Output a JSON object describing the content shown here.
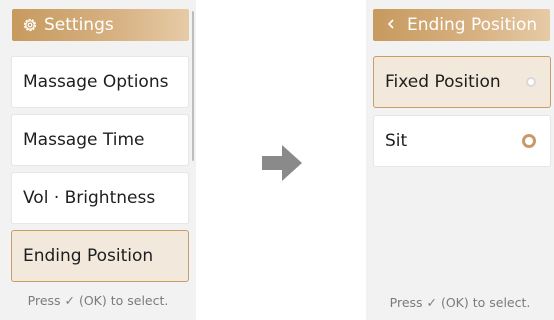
{
  "left_screen": {
    "header": {
      "title": "Settings",
      "icon": "gear-icon"
    },
    "items": [
      {
        "label": "Massage Options",
        "selected": false
      },
      {
        "label": "Massage Time",
        "selected": false
      },
      {
        "label": "Vol · Brightness",
        "selected": false
      },
      {
        "label": "Ending Position",
        "selected": true
      }
    ],
    "hint": "Press ✓ (OK) to select."
  },
  "right_screen": {
    "header": {
      "title": "Ending Position",
      "icon": "chevron-left-icon"
    },
    "options": [
      {
        "label": "Fixed Position",
        "selected": false,
        "highlighted": true
      },
      {
        "label": "Sit",
        "selected": true,
        "highlighted": false
      }
    ],
    "hint": "Press ✓ (OK) to select."
  },
  "colors": {
    "accent": "#c89d66",
    "header_gradient_start": "#c79a5e",
    "header_gradient_end": "#e6cba6",
    "selected_background": "#f3e8dc",
    "panel_background": "#f2f2f2",
    "arrow": "#8a8a8a"
  },
  "transition_icon": "arrow-right-icon"
}
